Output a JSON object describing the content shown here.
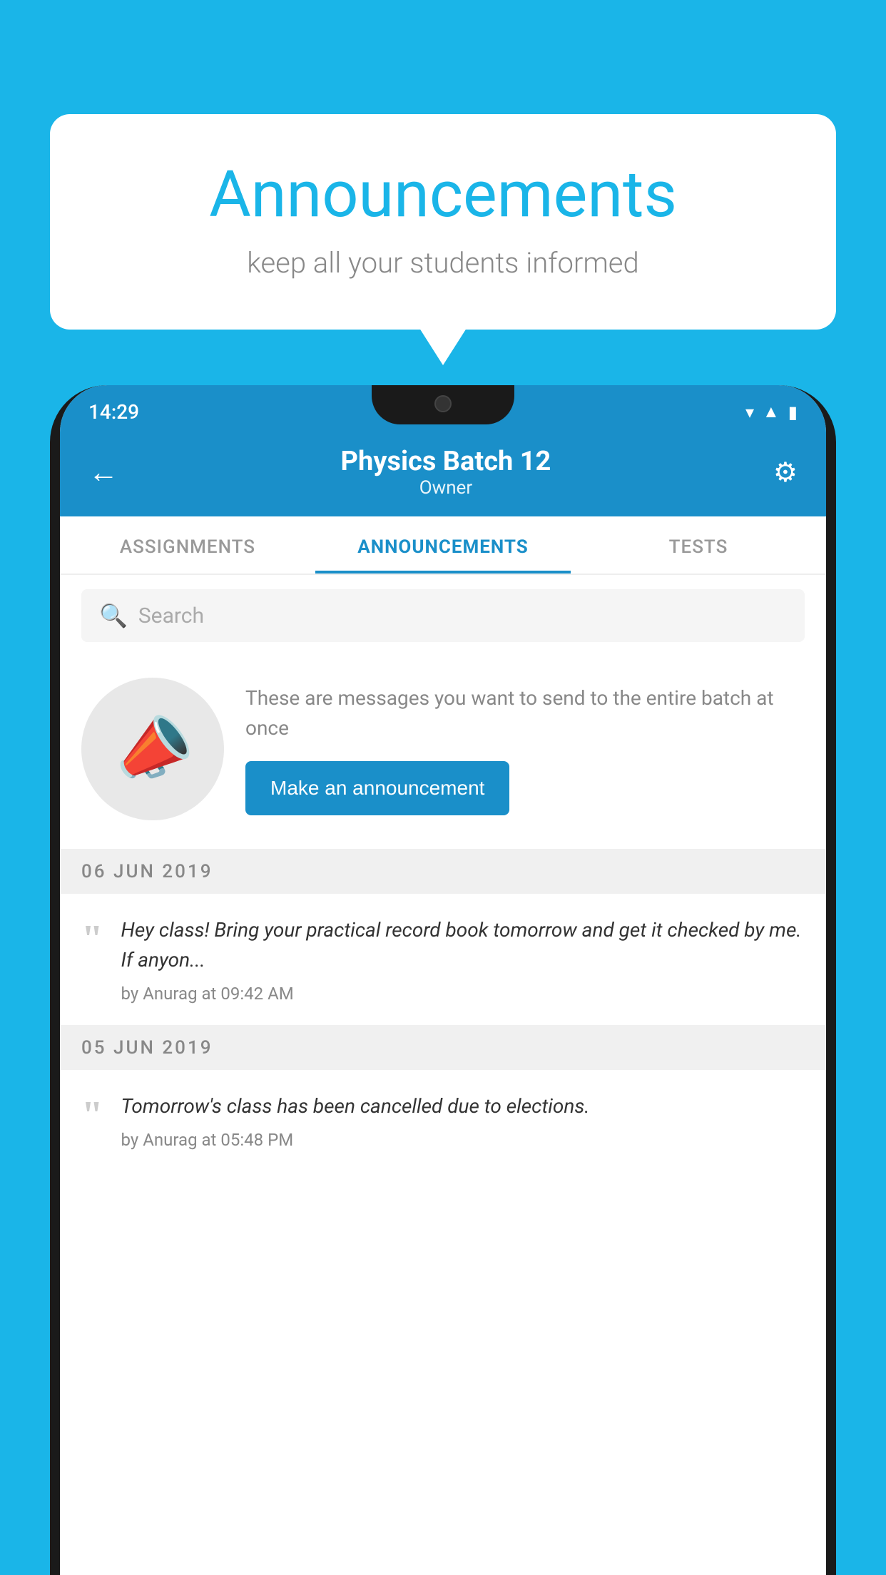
{
  "page": {
    "background_color": "#1ab5e8"
  },
  "speech_bubble": {
    "title": "Announcements",
    "subtitle": "keep all your students informed"
  },
  "status_bar": {
    "time": "14:29",
    "wifi_icon": "▾",
    "signal_icon": "▲",
    "battery_icon": "▮"
  },
  "header": {
    "back_label": "←",
    "title": "Physics Batch 12",
    "subtitle": "Owner",
    "gear_label": "⚙"
  },
  "tabs": [
    {
      "label": "ASSIGNMENTS",
      "active": false
    },
    {
      "label": "ANNOUNCEMENTS",
      "active": true
    },
    {
      "label": "TESTS",
      "active": false
    }
  ],
  "search": {
    "placeholder": "Search"
  },
  "promo": {
    "description_text": "These are messages you want to send to the entire batch at once",
    "button_label": "Make an announcement"
  },
  "announcements": [
    {
      "date": "06  JUN  2019",
      "text": "Hey class! Bring your practical record book tomorrow and get it checked by me. If anyon...",
      "meta": "by Anurag at 09:42 AM"
    },
    {
      "date": "05  JUN  2019",
      "text": "Tomorrow's class has been cancelled due to elections.",
      "meta": "by Anurag at 05:48 PM"
    }
  ]
}
